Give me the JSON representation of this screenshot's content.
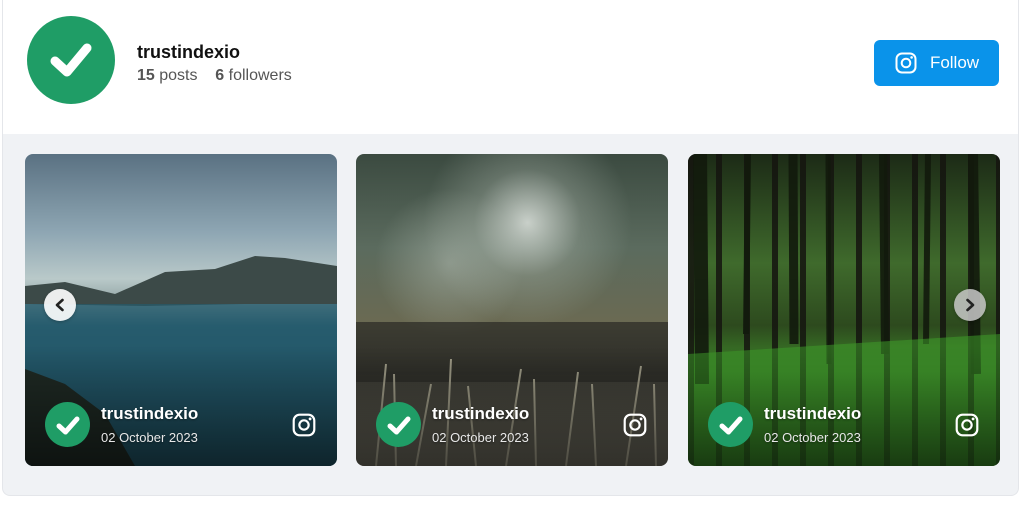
{
  "profile": {
    "name": "trustindexio",
    "posts_count": "15",
    "posts_label": "posts",
    "followers_count": "6",
    "followers_label": "followers",
    "follow_label": "Follow"
  },
  "colors": {
    "brand_green": "#1f9d66",
    "follow_blue": "#0a93ea"
  },
  "posts": [
    {
      "user": "trustindexio",
      "date": "02 October 2023",
      "image": "lake-mountains"
    },
    {
      "user": "trustindexio",
      "date": "02 October 2023",
      "image": "blurred-grass"
    },
    {
      "user": "trustindexio",
      "date": "02 October 2023",
      "image": "forest-trees"
    }
  ],
  "icons": {
    "avatar": "check-icon",
    "follow": "instagram-icon",
    "post_platform": "instagram-icon",
    "prev": "chevron-left-icon",
    "next": "chevron-right-icon"
  }
}
